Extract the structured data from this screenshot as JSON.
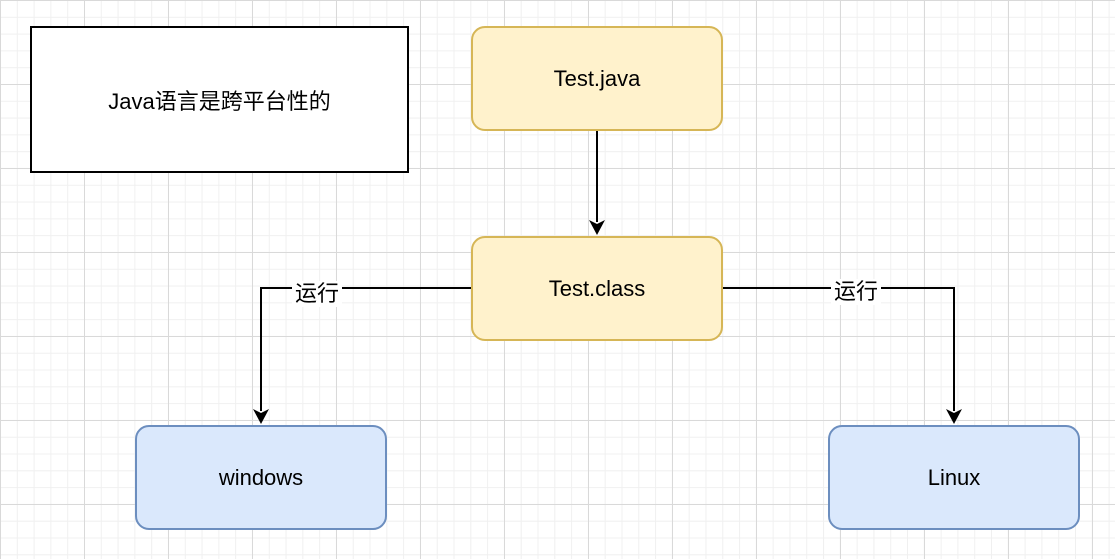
{
  "diagram": {
    "note": "Java语言是跨平台性的",
    "nodes": {
      "source": "Test.java",
      "bytecode": "Test.class",
      "windows": "windows",
      "linux": "Linux"
    },
    "edges": {
      "left_label": "运行",
      "right_label": "运行"
    },
    "colors": {
      "yellow_fill": "#fff2cc",
      "yellow_stroke": "#d6b656",
      "blue_fill": "#dae8fc",
      "blue_stroke": "#6c8ebf",
      "line": "#000000"
    }
  }
}
